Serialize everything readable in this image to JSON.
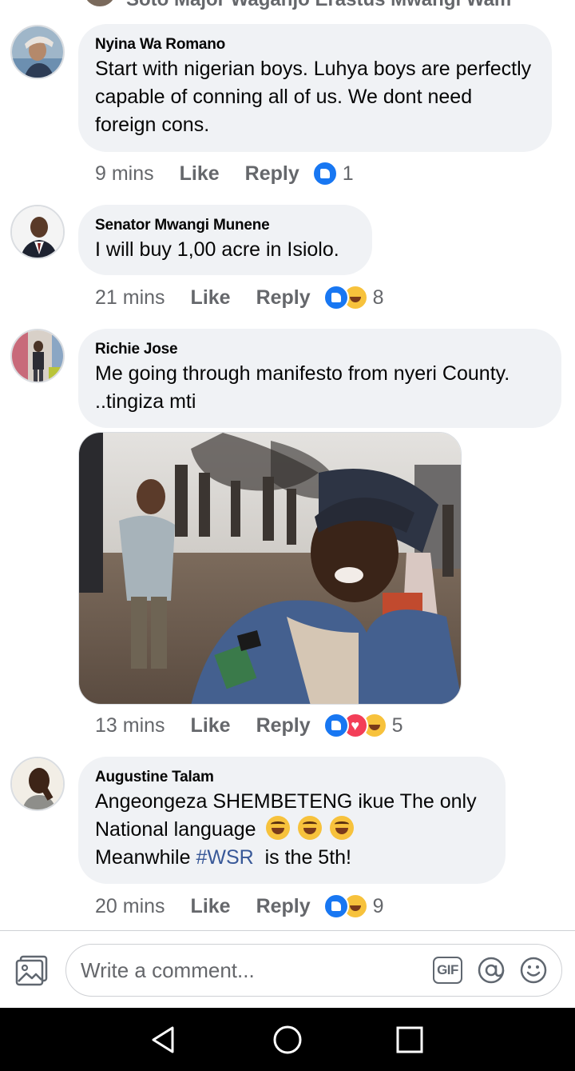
{
  "previous_comment": {
    "partial_text": "Soto Major Waganjo Erastus Mwangi Wam"
  },
  "comments": [
    {
      "author": "Nyina Wa Romano",
      "text": "Start with nigerian boys. Luhya boys are perfectly capable of conning all of us. We dont need foreign cons.",
      "time": "9 mins",
      "like_label": "Like",
      "reply_label": "Reply",
      "reactions": [
        "like"
      ],
      "reaction_count": "1"
    },
    {
      "author": "Senator Mwangi Munene",
      "text": "I will buy 1,00 acre in Isiolo.",
      "time": "21 mins",
      "like_label": "Like",
      "reply_label": "Reply",
      "reactions": [
        "like",
        "haha"
      ],
      "reaction_count": "8"
    },
    {
      "author": "Richie Jose",
      "text": "Me going through manifesto from nyeri County. ..tingiza mti",
      "time": "13 mins",
      "like_label": "Like",
      "reply_label": "Reply",
      "reactions": [
        "like",
        "love",
        "haha"
      ],
      "reaction_count": "5",
      "has_image": true
    },
    {
      "author": "Augustine Talam",
      "text_line1": "Angeongeza SHEMBETENG ikue The only",
      "text_line2": "National language",
      "text_line3_pre": "Meanwhile",
      "hashtag": "#WSR",
      "text_line3_post": "is the  5th!",
      "inline_emoji": [
        "laughing-emoji",
        "laughing-emoji",
        "laughing-emoji"
      ],
      "time": "20 mins",
      "like_label": "Like",
      "reply_label": "Reply",
      "reactions": [
        "like",
        "haha"
      ],
      "reaction_count": "9"
    }
  ],
  "composer": {
    "placeholder": "Write a comment...",
    "gif_label": "GIF",
    "icons": [
      "photo-icon",
      "gif-icon",
      "at-icon",
      "emoji-icon"
    ]
  },
  "navbar": {
    "icons": [
      "back-icon",
      "home-icon",
      "recents-icon"
    ]
  },
  "colors": {
    "bubble": "#f0f2f5",
    "meta_text": "#65676b",
    "like_blue": "#1877f2",
    "love_red": "#f33e58",
    "haha_yellow": "#f7c23c",
    "hashtag": "#385898"
  }
}
